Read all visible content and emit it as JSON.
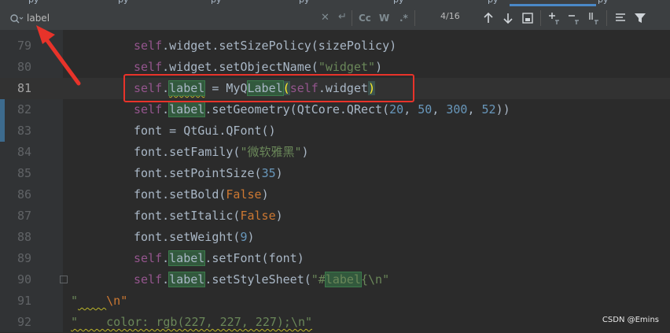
{
  "tabs": {
    "partial_labels": [
      "py",
      "py",
      "py",
      "py",
      "py",
      "py",
      "py"
    ]
  },
  "find": {
    "query": "label",
    "match_count": "4/16",
    "case_label": "Cc",
    "word_label": "W",
    "regex_label": ".*"
  },
  "editor": {
    "current_line": 81,
    "colors": {
      "background": "#2b2b2b",
      "gutter": "#313335",
      "self": "#94558d",
      "string": "#6a8759",
      "number": "#6897bb",
      "keyword": "#cc7832",
      "match_highlight": "#32593d",
      "annotation_red": "#e8332a"
    },
    "lines": [
      {
        "n": "79"
      },
      {
        "n": "80"
      },
      {
        "n": "81"
      },
      {
        "n": "82"
      },
      {
        "n": "83"
      },
      {
        "n": "84"
      },
      {
        "n": "85"
      },
      {
        "n": "86"
      },
      {
        "n": "87"
      },
      {
        "n": "88"
      },
      {
        "n": "89"
      },
      {
        "n": "90"
      },
      {
        "n": "91"
      },
      {
        "n": "92"
      }
    ],
    "tokens": {
      "self": "self",
      "l79_rest": ".widget.setSizePolicy(sizePolicy)",
      "l80_a": ".widget.setObjectName(",
      "l80_str": "\"widget\"",
      "l80_b": ")",
      "label": "label",
      "l81_a": " = MyQ",
      "l81_Label": "Label",
      "l81_paren_open": "(",
      "l81_b": ".widget",
      "l81_paren_close": ")",
      "l82_a": ".setGeometry(QtCore.QRect(",
      "l82_n1": "20",
      "comma": ", ",
      "l82_n2": "50",
      "l82_n3": "300",
      "l82_n4": "52",
      "l82_b": "))",
      "l83": "font = QtGui.QFont()",
      "l84_a": "font.setFamily(",
      "l84_str": "\"微软雅黑\"",
      "l84_b": ")",
      "l85_a": "font.setPointSize(",
      "l85_n": "35",
      "l85_b": ")",
      "l86_a": "font.setBold(",
      "l86_kw": "False",
      "l86_b": ")",
      "l87_a": "font.setItalic(",
      "l87_kw": "False",
      "l87_b": ")",
      "l88_a": "font.setWeight(",
      "l88_n": "9",
      "l88_b": ")",
      "l89_rest": ".setFont(font)",
      "l90_a": ".setStyleSheet(",
      "l90_str_a": "\"#",
      "l90_str_b": "{\\n\"",
      "l91_a": "\"",
      "l91_b": "    ",
      "l91_c": "\\n\"",
      "l92": "\"    color: rgb(227, 227, 227);\\n\""
    }
  },
  "watermark": "CSDN @Emins"
}
